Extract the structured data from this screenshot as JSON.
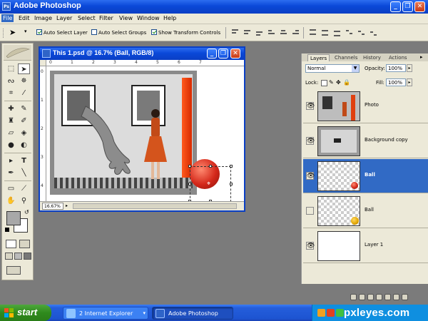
{
  "app": {
    "title": "Adobe Photoshop",
    "logo": "Ps"
  },
  "window_controls": {
    "minimize": "_",
    "restore": "❐",
    "close": "✕"
  },
  "menu": [
    "File",
    "Edit",
    "Image",
    "Layer",
    "Select",
    "Filter",
    "View",
    "Window",
    "Help"
  ],
  "options": {
    "auto_select_layer": {
      "label": "Auto Select Layer",
      "checked": true
    },
    "auto_select_groups": {
      "label": "Auto Select Groups",
      "checked": false
    },
    "show_transform_controls": {
      "label": "Show Transform Controls",
      "checked": true
    }
  },
  "document": {
    "title": "This 1.psd @ 16.7% (Ball, RGB/8)",
    "zoom": "16.67%",
    "ruler_h": [
      "0",
      "1",
      "2",
      "3",
      "4",
      "5",
      "6",
      "7"
    ],
    "ruler_v": [
      "0",
      "1",
      "2",
      "3",
      "4"
    ]
  },
  "layers_panel": {
    "tabs": [
      "Layers",
      "Channels",
      "History",
      "Actions"
    ],
    "blend_mode": "Normal",
    "opacity_label": "Opacity:",
    "opacity": "100%",
    "lock_label": "Lock:",
    "fill_label": "Fill:",
    "fill": "100%",
    "layers": [
      {
        "name": "Photo",
        "visible": true,
        "selected": false
      },
      {
        "name": "Background copy",
        "visible": true,
        "selected": false
      },
      {
        "name": "Ball",
        "visible": true,
        "selected": true
      },
      {
        "name": "Ball",
        "visible": false,
        "selected": false
      },
      {
        "name": "Layer 1",
        "visible": true,
        "selected": false
      }
    ]
  },
  "taskbar": {
    "start": "start",
    "tasks": [
      "2 Internet Explorer",
      "Adobe Photoshop"
    ]
  },
  "watermark": "pxleyes.com",
  "colors": {
    "xp_blue": "#0a48d8",
    "selection": "#316ac5",
    "ball_red": "#d4281a",
    "ball_yellow": "#e0a400",
    "panel_gray": "#ece9d8"
  }
}
